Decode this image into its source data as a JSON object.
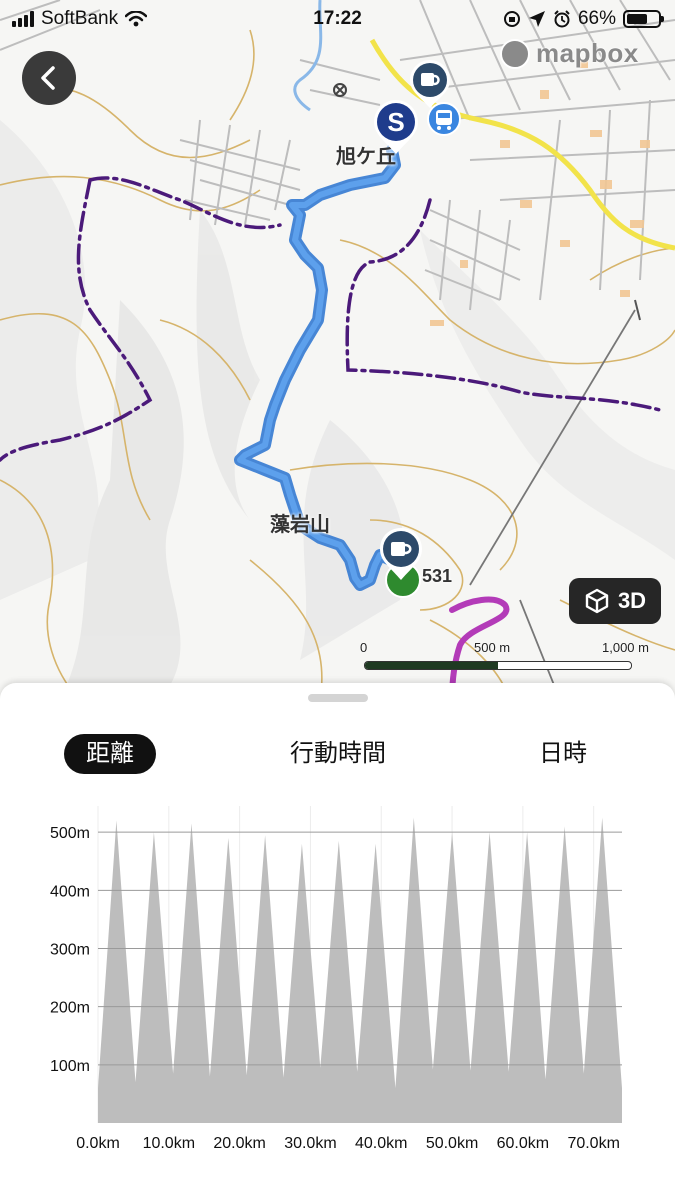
{
  "status_bar": {
    "carrier": "SoftBank",
    "time": "17:22",
    "battery_percent": "66%",
    "battery_level": 0.66
  },
  "map": {
    "attribution": "mapbox",
    "labels": {
      "town": "旭ケ丘",
      "mountain": "藻岩山",
      "peak_number": "531"
    },
    "button_3d": "3D",
    "scale": {
      "start": "0",
      "mid": "500 m",
      "end": "1,000 m"
    },
    "colors": {
      "route": "#4a8ee0",
      "boundary": "#4b1a7a",
      "road": "#f2e34a",
      "contour": "#d6b46b",
      "trail": "#b33bb8"
    }
  },
  "tabs": [
    {
      "label": "距離",
      "active": true
    },
    {
      "label": "行動時間",
      "active": false
    },
    {
      "label": "日時",
      "active": false
    }
  ],
  "chart_data": {
    "type": "area",
    "xlabel": "",
    "ylabel": "",
    "x_ticks": [
      "0.0km",
      "10.0km",
      "20.0km",
      "30.0km",
      "40.0km",
      "50.0km",
      "60.0km",
      "70.0km"
    ],
    "y_ticks": [
      "100m",
      "200m",
      "300m",
      "400m",
      "500m"
    ],
    "xlim": [
      0,
      74
    ],
    "ylim": [
      0,
      545
    ],
    "grid": true,
    "series": [
      {
        "x": [
          0,
          2.6,
          5.3,
          7.9,
          10.6,
          13.2,
          15.8,
          18.4,
          21.0,
          23.6,
          26.2,
          28.8,
          31.4,
          34.0,
          36.6,
          39.2,
          42.0,
          44.6,
          47.3,
          50.0,
          52.6,
          55.3,
          58.0,
          60.6,
          63.2,
          65.9,
          68.6,
          71.2,
          74.0
        ],
        "values": [
          60,
          520,
          70,
          500,
          85,
          515,
          80,
          490,
          82,
          495,
          78,
          480,
          95,
          485,
          88,
          480,
          60,
          525,
          92,
          500,
          90,
          500,
          88,
          500,
          75,
          510,
          85,
          525,
          60
        ]
      }
    ]
  }
}
